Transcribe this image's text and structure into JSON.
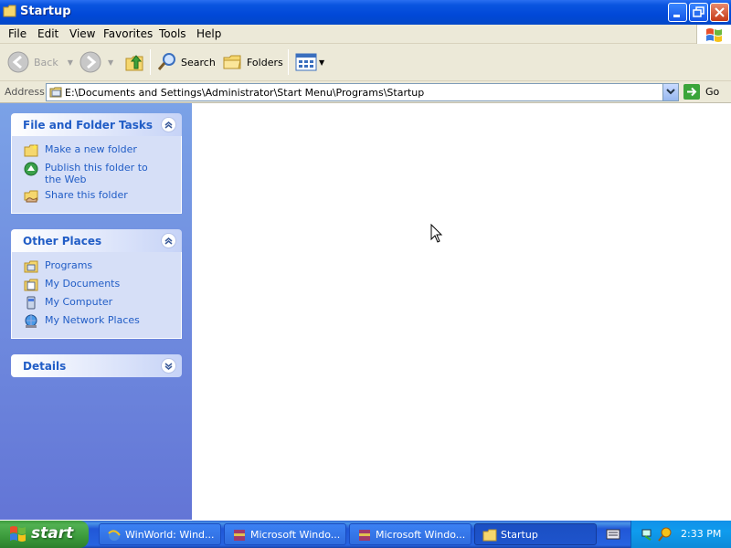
{
  "window": {
    "title": "Startup"
  },
  "menu": [
    "File",
    "Edit",
    "View",
    "Favorites",
    "Tools",
    "Help"
  ],
  "toolbar": {
    "back": "Back",
    "search": "Search",
    "folders": "Folders"
  },
  "address": {
    "label": "Address",
    "value": "E:\\Documents and Settings\\Administrator\\Start Menu\\Programs\\Startup",
    "go": "Go"
  },
  "left_pane": {
    "file_tasks": {
      "title": "File and Folder Tasks",
      "items": [
        "Make a new folder",
        "Publish this folder to the Web",
        "Share this folder"
      ]
    },
    "other_places": {
      "title": "Other Places",
      "items": [
        "Programs",
        "My Documents",
        "My Computer",
        "My Network Places"
      ]
    },
    "details": {
      "title": "Details"
    }
  },
  "taskbar": {
    "start": "start",
    "items": [
      "WinWorld: Wind...",
      "Microsoft Windo...",
      "Microsoft Windo...",
      "Startup"
    ],
    "clock": "2:33 PM"
  },
  "colors": {
    "title_blue": "#0148d8",
    "task_link": "#215dc6",
    "start_green": "#3b9a3b"
  }
}
